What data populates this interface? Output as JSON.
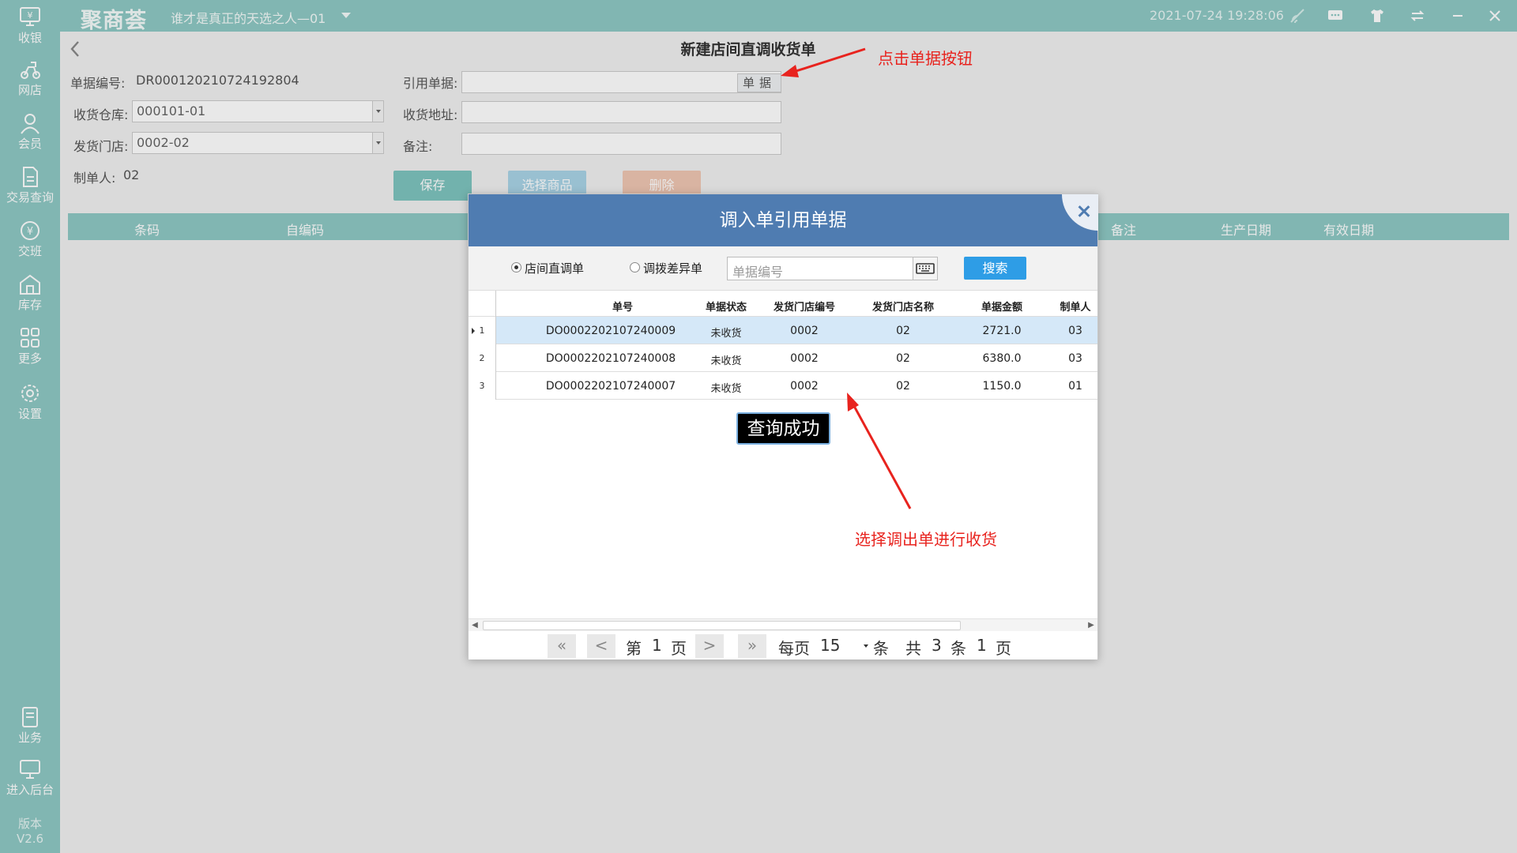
{
  "topbar": {
    "logo": "聚商荟",
    "store_name": "谁才是真正的天选之人—01",
    "datetime": "2021-07-24 19:28:06"
  },
  "sidebar": {
    "items": [
      {
        "label": "收银",
        "icon": "cashier-icon"
      },
      {
        "label": "网店",
        "icon": "delivery-icon"
      },
      {
        "label": "会员",
        "icon": "member-icon"
      },
      {
        "label": "交易查询",
        "icon": "document-icon"
      },
      {
        "label": "交班",
        "icon": "shift-icon"
      },
      {
        "label": "库存",
        "icon": "warehouse-icon"
      },
      {
        "label": "更多",
        "icon": "grid-icon"
      },
      {
        "label": "设置",
        "icon": "gear-icon"
      },
      {
        "label": "业务",
        "icon": "book-icon"
      },
      {
        "label": "进入后台",
        "icon": "monitor-icon"
      }
    ],
    "version_label": "版本",
    "version": "V2.6"
  },
  "page": {
    "title": "新建店间直调收货单",
    "doc_no_label": "单据编号:",
    "doc_no": "DR000120210724192804",
    "ref_doc_label": "引用单据:",
    "ref_button": "单据",
    "warehouse_label": "收货仓库:",
    "warehouse": "000101-01",
    "address_label": "收货地址:",
    "send_store_label": "发货门店:",
    "send_store": "0002-02",
    "remark_label": "备注:",
    "maker_label": "制单人:",
    "maker": "02",
    "save_btn": "保存",
    "select_btn": "选择商品",
    "delete_btn": "删除",
    "grid_columns": [
      "条码",
      "自编码",
      "备注",
      "生产日期",
      "有效日期"
    ]
  },
  "dialog": {
    "title": "调入单引用单据",
    "radio_1": "店间直调单",
    "radio_2": "调拨差异单",
    "search_placeholder": "单据编号",
    "search_btn": "搜索",
    "columns": [
      "单号",
      "单据状态",
      "发货门店编号",
      "发货门店名称",
      "单据金额",
      "制单人"
    ],
    "rows": [
      {
        "n": "1",
        "no": "DO0002202107240009",
        "status": "未收货",
        "store_code": "0002",
        "store_name": "02",
        "amount": "2721.0",
        "maker": "03"
      },
      {
        "n": "2",
        "no": "DO0002202107240008",
        "status": "未收货",
        "store_code": "0002",
        "store_name": "02",
        "amount": "6380.0",
        "maker": "03"
      },
      {
        "n": "3",
        "no": "DO0002202107240007",
        "status": "未收货",
        "store_code": "0002",
        "store_name": "02",
        "amount": "1150.0",
        "maker": "01"
      }
    ],
    "toast": "查询成功",
    "pager": {
      "first": "«",
      "prev": "<",
      "next": ">",
      "last": "»",
      "page_prefix": "第",
      "page": "1",
      "page_suffix": "页",
      "per_page_label": "每页",
      "per_page": "15",
      "per_page_unit": "条",
      "total_prefix": "共",
      "total": "3",
      "total_unit": "条",
      "total_pages": "1",
      "total_pages_unit": "页"
    }
  },
  "annotations": {
    "click_button": "点击单据按钮",
    "select_order": "选择调出单进行收货"
  },
  "colors": {
    "teal": "#8ec9c4",
    "dialog_header": "#4f7cb1",
    "annotation": "#e8231e"
  }
}
